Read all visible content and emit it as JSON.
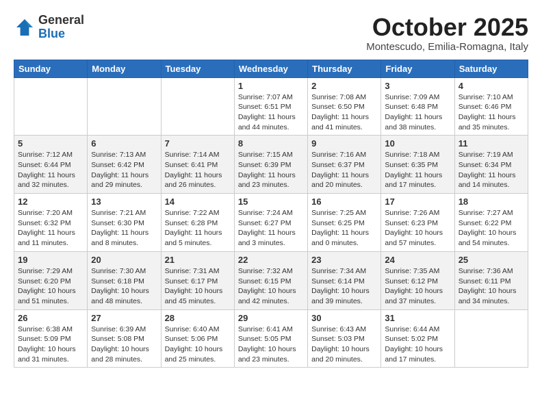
{
  "logo": {
    "general": "General",
    "blue": "Blue"
  },
  "title": "October 2025",
  "subtitle": "Montescudo, Emilia-Romagna, Italy",
  "weekdays": [
    "Sunday",
    "Monday",
    "Tuesday",
    "Wednesday",
    "Thursday",
    "Friday",
    "Saturday"
  ],
  "weeks": [
    [
      {
        "day": "",
        "info": ""
      },
      {
        "day": "",
        "info": ""
      },
      {
        "day": "",
        "info": ""
      },
      {
        "day": "1",
        "info": "Sunrise: 7:07 AM\nSunset: 6:51 PM\nDaylight: 11 hours\nand 44 minutes."
      },
      {
        "day": "2",
        "info": "Sunrise: 7:08 AM\nSunset: 6:50 PM\nDaylight: 11 hours\nand 41 minutes."
      },
      {
        "day": "3",
        "info": "Sunrise: 7:09 AM\nSunset: 6:48 PM\nDaylight: 11 hours\nand 38 minutes."
      },
      {
        "day": "4",
        "info": "Sunrise: 7:10 AM\nSunset: 6:46 PM\nDaylight: 11 hours\nand 35 minutes."
      }
    ],
    [
      {
        "day": "5",
        "info": "Sunrise: 7:12 AM\nSunset: 6:44 PM\nDaylight: 11 hours\nand 32 minutes."
      },
      {
        "day": "6",
        "info": "Sunrise: 7:13 AM\nSunset: 6:42 PM\nDaylight: 11 hours\nand 29 minutes."
      },
      {
        "day": "7",
        "info": "Sunrise: 7:14 AM\nSunset: 6:41 PM\nDaylight: 11 hours\nand 26 minutes."
      },
      {
        "day": "8",
        "info": "Sunrise: 7:15 AM\nSunset: 6:39 PM\nDaylight: 11 hours\nand 23 minutes."
      },
      {
        "day": "9",
        "info": "Sunrise: 7:16 AM\nSunset: 6:37 PM\nDaylight: 11 hours\nand 20 minutes."
      },
      {
        "day": "10",
        "info": "Sunrise: 7:18 AM\nSunset: 6:35 PM\nDaylight: 11 hours\nand 17 minutes."
      },
      {
        "day": "11",
        "info": "Sunrise: 7:19 AM\nSunset: 6:34 PM\nDaylight: 11 hours\nand 14 minutes."
      }
    ],
    [
      {
        "day": "12",
        "info": "Sunrise: 7:20 AM\nSunset: 6:32 PM\nDaylight: 11 hours\nand 11 minutes."
      },
      {
        "day": "13",
        "info": "Sunrise: 7:21 AM\nSunset: 6:30 PM\nDaylight: 11 hours\nand 8 minutes."
      },
      {
        "day": "14",
        "info": "Sunrise: 7:22 AM\nSunset: 6:28 PM\nDaylight: 11 hours\nand 5 minutes."
      },
      {
        "day": "15",
        "info": "Sunrise: 7:24 AM\nSunset: 6:27 PM\nDaylight: 11 hours\nand 3 minutes."
      },
      {
        "day": "16",
        "info": "Sunrise: 7:25 AM\nSunset: 6:25 PM\nDaylight: 11 hours\nand 0 minutes."
      },
      {
        "day": "17",
        "info": "Sunrise: 7:26 AM\nSunset: 6:23 PM\nDaylight: 10 hours\nand 57 minutes."
      },
      {
        "day": "18",
        "info": "Sunrise: 7:27 AM\nSunset: 6:22 PM\nDaylight: 10 hours\nand 54 minutes."
      }
    ],
    [
      {
        "day": "19",
        "info": "Sunrise: 7:29 AM\nSunset: 6:20 PM\nDaylight: 10 hours\nand 51 minutes."
      },
      {
        "day": "20",
        "info": "Sunrise: 7:30 AM\nSunset: 6:18 PM\nDaylight: 10 hours\nand 48 minutes."
      },
      {
        "day": "21",
        "info": "Sunrise: 7:31 AM\nSunset: 6:17 PM\nDaylight: 10 hours\nand 45 minutes."
      },
      {
        "day": "22",
        "info": "Sunrise: 7:32 AM\nSunset: 6:15 PM\nDaylight: 10 hours\nand 42 minutes."
      },
      {
        "day": "23",
        "info": "Sunrise: 7:34 AM\nSunset: 6:14 PM\nDaylight: 10 hours\nand 39 minutes."
      },
      {
        "day": "24",
        "info": "Sunrise: 7:35 AM\nSunset: 6:12 PM\nDaylight: 10 hours\nand 37 minutes."
      },
      {
        "day": "25",
        "info": "Sunrise: 7:36 AM\nSunset: 6:11 PM\nDaylight: 10 hours\nand 34 minutes."
      }
    ],
    [
      {
        "day": "26",
        "info": "Sunrise: 6:38 AM\nSunset: 5:09 PM\nDaylight: 10 hours\nand 31 minutes."
      },
      {
        "day": "27",
        "info": "Sunrise: 6:39 AM\nSunset: 5:08 PM\nDaylight: 10 hours\nand 28 minutes."
      },
      {
        "day": "28",
        "info": "Sunrise: 6:40 AM\nSunset: 5:06 PM\nDaylight: 10 hours\nand 25 minutes."
      },
      {
        "day": "29",
        "info": "Sunrise: 6:41 AM\nSunset: 5:05 PM\nDaylight: 10 hours\nand 23 minutes."
      },
      {
        "day": "30",
        "info": "Sunrise: 6:43 AM\nSunset: 5:03 PM\nDaylight: 10 hours\nand 20 minutes."
      },
      {
        "day": "31",
        "info": "Sunrise: 6:44 AM\nSunset: 5:02 PM\nDaylight: 10 hours\nand 17 minutes."
      },
      {
        "day": "",
        "info": ""
      }
    ]
  ]
}
